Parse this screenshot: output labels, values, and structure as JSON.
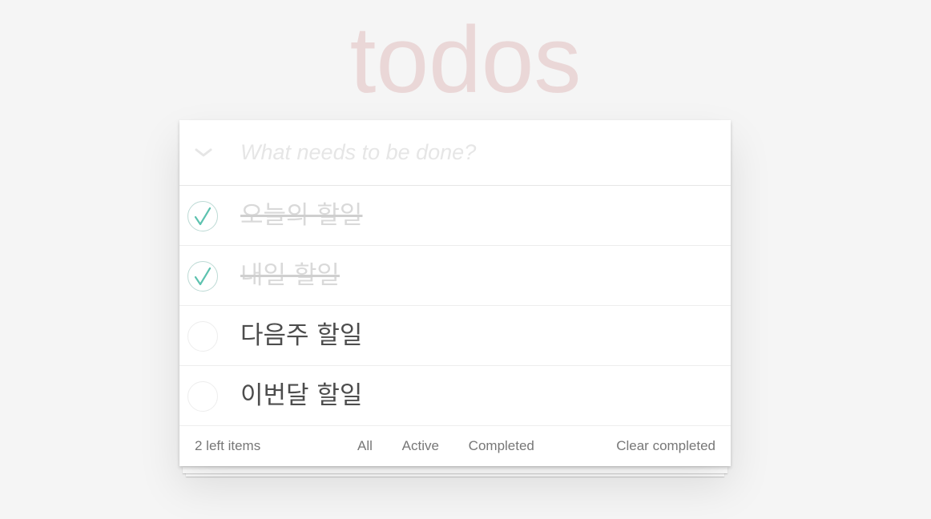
{
  "app": {
    "title": "todos"
  },
  "new_todo": {
    "placeholder": "What needs to be done?",
    "value": ""
  },
  "todos": [
    {
      "label": "오늘의 할일",
      "completed": true
    },
    {
      "label": "내일 할일",
      "completed": true
    },
    {
      "label": "다음주 할일",
      "completed": false
    },
    {
      "label": "이번달 할일",
      "completed": false
    }
  ],
  "footer": {
    "count_text": "2 left items",
    "filters": [
      "All",
      "Active",
      "Completed"
    ],
    "clear_completed": "Clear completed"
  },
  "icons": {
    "toggle_all": "chevron-down-icon",
    "checked": "checkmark-circle-icon",
    "unchecked": "empty-circle-icon"
  },
  "colors": {
    "title": "#efd5d5",
    "check": "#5dc2af",
    "check_circle": "#bddad5",
    "empty_circle": "#ededed",
    "completed_text": "#d9d9d9"
  }
}
